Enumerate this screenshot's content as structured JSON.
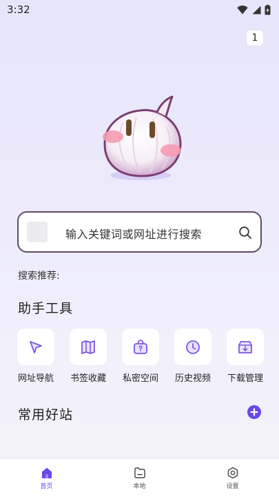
{
  "status_bar": {
    "time": "3:32"
  },
  "tab_counter": "1",
  "search": {
    "placeholder": "输入关键词或网址进行搜索"
  },
  "recommend_label": "搜索推荐:",
  "tools_section": {
    "title": "助手工具",
    "items": [
      {
        "label": "网址导航",
        "icon": "navigation-arrow-icon"
      },
      {
        "label": "书签收藏",
        "icon": "map-bookmark-icon"
      },
      {
        "label": "私密空间",
        "icon": "private-bag-icon"
      },
      {
        "label": "历史视频",
        "icon": "clock-icon"
      },
      {
        "label": "下载管理",
        "icon": "download-box-icon"
      }
    ]
  },
  "sites_section": {
    "title": "常用好站"
  },
  "bottom_nav": {
    "items": [
      {
        "label": "首页",
        "icon": "home-icon",
        "active": true
      },
      {
        "label": "本地",
        "icon": "folder-icon",
        "active": false
      },
      {
        "label": "设置",
        "icon": "settings-icon",
        "active": false
      }
    ]
  },
  "colors": {
    "accent": "#6a47e8",
    "icon_purple": "#7b55e0",
    "search_border": "#5f4a63",
    "background_top": "#e6e5fb"
  }
}
